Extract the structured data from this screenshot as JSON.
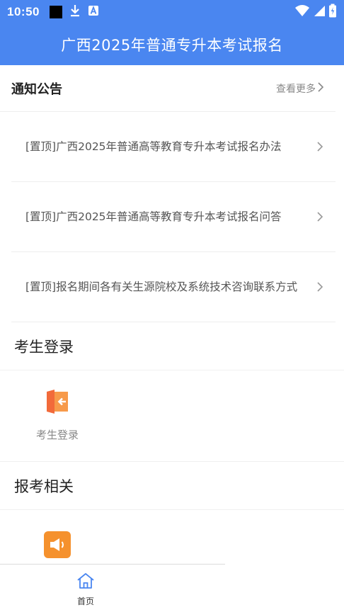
{
  "status_bar": {
    "time": "10:50",
    "icons": [
      "black-square-icon",
      "download-icon",
      "text-a-icon",
      "wifi-icon",
      "signal-icon",
      "battery-icon"
    ]
  },
  "header": {
    "title": "广西2025年普通专升本考试报名"
  },
  "notices": {
    "title": "通知公告",
    "view_more": "查看更多",
    "items": [
      {
        "text": "[置顶]广西2025年普通高等教育专升本考试报名办法"
      },
      {
        "text": "[置顶]广西2025年普通高等教育专升本考试报名问答"
      },
      {
        "text": "[置顶]报名期间各有关生源院校及系统技术咨询联系方式"
      }
    ]
  },
  "login_section": {
    "title": "考生登录",
    "tile_label": "考生登录",
    "tile_icon": "door-login-icon"
  },
  "related_section": {
    "title": "报考相关",
    "tile_icon": "megaphone-icon"
  },
  "bottom_nav": {
    "home_label": "首页",
    "home_icon": "home-icon"
  },
  "colors": {
    "primary": "#4a86f0",
    "orange": "#f5912d",
    "red_orange": "#f26a3a"
  }
}
